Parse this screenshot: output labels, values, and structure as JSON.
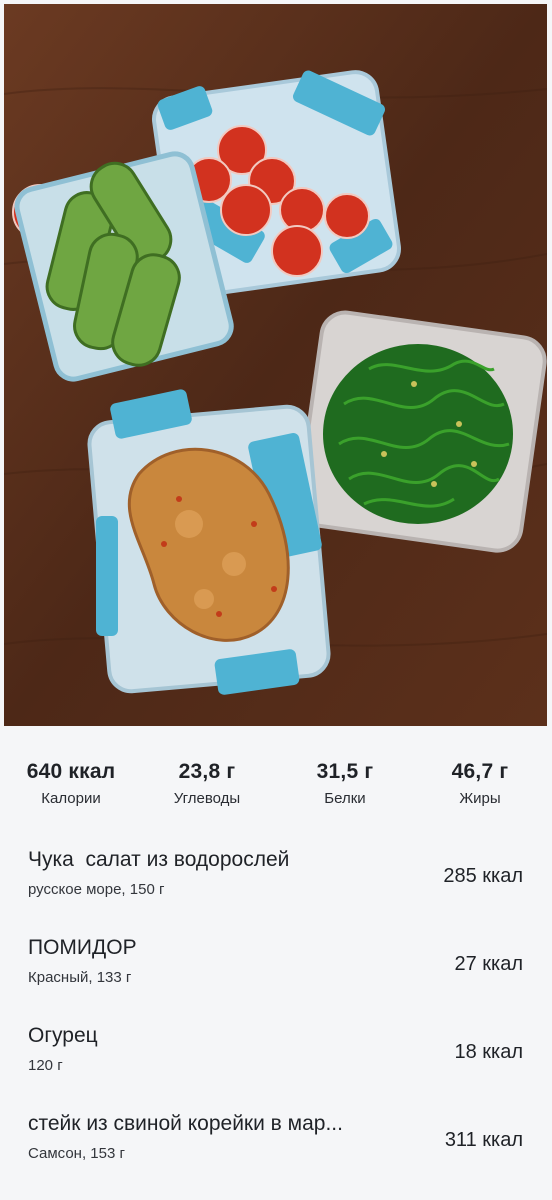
{
  "summary": [
    {
      "value": "640 ккал",
      "label": "Калории"
    },
    {
      "value": "23,8 г",
      "label": "Углеводы"
    },
    {
      "value": "31,5 г",
      "label": "Белки"
    },
    {
      "value": "46,7 г",
      "label": "Жиры"
    }
  ],
  "foods": [
    {
      "name": "Чука  салат из водорослей",
      "detail": "русское море, 150 г",
      "kcal": "285 ккал"
    },
    {
      "name": "ПОМИДОР",
      "detail": "Красный, 133 г",
      "kcal": "27 ккал"
    },
    {
      "name": "Огурец",
      "detail": "120 г",
      "kcal": "18 ккал"
    },
    {
      "name": "стейк из свиной корейки в мар...",
      "detail": "Самсон, 153 г",
      "kcal": "311 ккал"
    }
  ],
  "colors": {
    "background": "#f5f6f8",
    "text": "#1f2227",
    "table": "#5a2f1c",
    "container_lid": "#4fb3d3"
  }
}
